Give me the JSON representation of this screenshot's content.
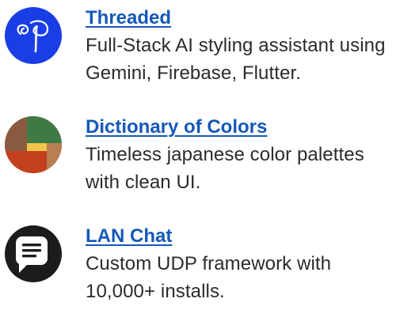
{
  "projects": [
    {
      "title": "Threaded",
      "description": "Full-Stack AI styling assistant using Gemini, Firebase, Flutter.",
      "icon": "threaded-needle-logo",
      "icon_bg": "#1a3ee6"
    },
    {
      "title": "Dictionary of Colors",
      "description": "Timeless japanese color palettes with clean UI.",
      "icon": "color-palette-logo",
      "palette": [
        "#3f7a45",
        "#8a5a40",
        "#f0c44a",
        "#b87f52",
        "#c3401f"
      ]
    },
    {
      "title": "LAN Chat",
      "description": "Custom UDP framework with 10,000+ installs.",
      "icon": "chat-bubble-logo",
      "icon_bg": "#1c1c1c"
    }
  ],
  "colors": {
    "link": "#1558b8",
    "text": "#2b2b2b"
  }
}
